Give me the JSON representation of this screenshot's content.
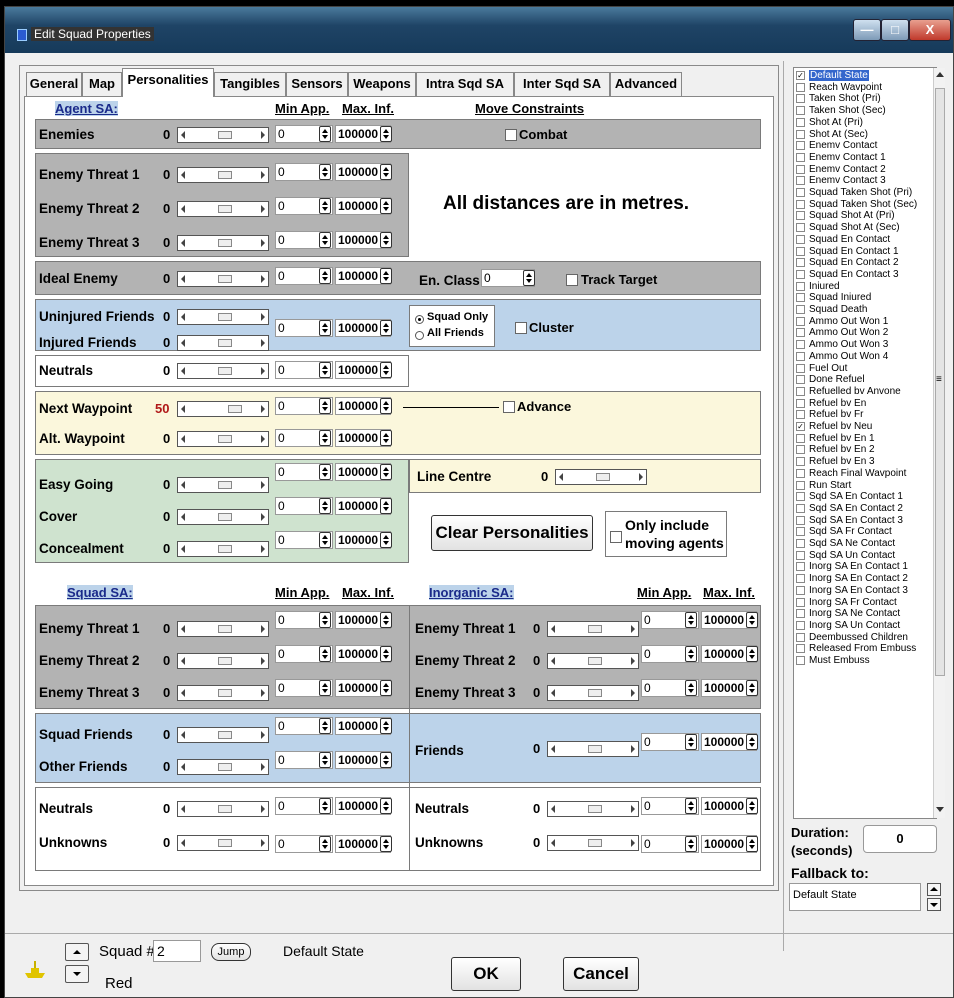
{
  "window": {
    "title": "Edit Squad Properties",
    "min": "—",
    "max": "□",
    "close": "X"
  },
  "tabs": [
    "General",
    "Map",
    "Personalities",
    "Tangibles",
    "Sensors",
    "Weapons",
    "Intra Sqd SA",
    "Inter Sqd SA",
    "Advanced"
  ],
  "active_tab": "Personalities",
  "agent_sa": {
    "header": "Agent SA:",
    "min_app": "Min App.",
    "max_inf": "Max. Inf.",
    "move_constraints": "Move Constraints",
    "rows": {
      "enemies": {
        "label": "Enemies",
        "value": "0",
        "min": "0",
        "max": "100000"
      },
      "enemy_threat_1": {
        "label": "Enemy Threat 1",
        "value": "0",
        "min": "0",
        "max": "100000"
      },
      "enemy_threat_2": {
        "label": "Enemy Threat 2",
        "value": "0",
        "min": "0",
        "max": "100000"
      },
      "enemy_threat_3": {
        "label": "Enemy Threat 3",
        "value": "0",
        "min": "0",
        "max": "100000"
      },
      "ideal_enemy": {
        "label": "Ideal Enemy",
        "value": "0",
        "min": "0",
        "max": "100000"
      },
      "uninjured_friends": {
        "label": "Uninjured Friends",
        "value": "0"
      },
      "injured_friends": {
        "label": "Injured Friends",
        "value": "0"
      },
      "friends_min": "0",
      "friends_max": "100000",
      "neutrals": {
        "label": "Neutrals",
        "value": "0",
        "min": "0",
        "max": "100000"
      },
      "next_waypoint": {
        "label": "Next Waypoint",
        "value": "50",
        "min": "0",
        "max": "100000"
      },
      "alt_waypoint": {
        "label": "Alt. Waypoint",
        "value": "0",
        "min": "0",
        "max": "100000"
      },
      "easy_going": {
        "label": "Easy Going",
        "value": "0",
        "min": "0",
        "max": "100000"
      },
      "cover": {
        "label": "Cover",
        "value": "0",
        "min": "0",
        "max": "100000"
      },
      "concealment": {
        "label": "Concealment",
        "value": "0",
        "min": "0",
        "max": "100000"
      }
    },
    "combat": "Combat",
    "distances_note": "All distances are in metres.",
    "en_class_label": "En. Class",
    "en_class_value": "0",
    "track_target": "Track Target",
    "squad_only": "Squad Only",
    "all_friends": "All Friends",
    "cluster": "Cluster",
    "advance": "Advance",
    "line_centre": "Line Centre",
    "line_centre_value": "0",
    "clear_button": "Clear Personalities",
    "only_include": "Only include",
    "moving_agents": "moving agents"
  },
  "squad_sa": {
    "header": "Squad SA:",
    "min_app": "Min App.",
    "max_inf": "Max. Inf.",
    "rows": [
      {
        "label": "Enemy Threat 1",
        "value": "0",
        "min": "0",
        "max": "100000"
      },
      {
        "label": "Enemy Threat 2",
        "value": "0",
        "min": "0",
        "max": "100000"
      },
      {
        "label": "Enemy Threat 3",
        "value": "0",
        "min": "0",
        "max": "100000"
      },
      {
        "label": "Squad Friends",
        "value": "0",
        "min": "0",
        "max": "100000"
      },
      {
        "label": "Other Friends",
        "value": "0",
        "min": "0",
        "max": "100000"
      },
      {
        "label": "Neutrals",
        "value": "0",
        "min": "0",
        "max": "100000"
      },
      {
        "label": "Unknowns",
        "value": "0",
        "min": "0",
        "max": "100000"
      }
    ]
  },
  "inorganic_sa": {
    "header": "Inorganic SA:",
    "min_app": "Min App.",
    "max_inf": "Max. Inf.",
    "rows": [
      {
        "label": "Enemy Threat 1",
        "value": "0",
        "min": "0",
        "max": "100000"
      },
      {
        "label": "Enemy Threat 2",
        "value": "0",
        "min": "0",
        "max": "100000"
      },
      {
        "label": "Enemy Threat 3",
        "value": "0",
        "min": "0",
        "max": "100000"
      },
      {
        "label": "Friends",
        "value": "0",
        "min": "0",
        "max": "100000"
      },
      {
        "label": "Neutrals",
        "value": "0",
        "min": "0",
        "max": "100000"
      },
      {
        "label": "Unknowns",
        "value": "0",
        "min": "0",
        "max": "100000"
      }
    ]
  },
  "states": [
    {
      "label": "Default State",
      "checked": true,
      "selected": true
    },
    {
      "label": "Reach Wavpoint",
      "checked": false
    },
    {
      "label": "Taken Shot (Pri)",
      "checked": false
    },
    {
      "label": "Taken Shot (Sec)",
      "checked": false
    },
    {
      "label": "Shot At (Pri)",
      "checked": false
    },
    {
      "label": "Shot At (Sec)",
      "checked": false
    },
    {
      "label": "Enemv Contact",
      "checked": false
    },
    {
      "label": "Enemv Contact 1",
      "checked": false
    },
    {
      "label": "Enemv Contact 2",
      "checked": false
    },
    {
      "label": "Enemv Contact 3",
      "checked": false
    },
    {
      "label": "Squad Taken Shot (Pri)",
      "checked": false
    },
    {
      "label": "Squad Taken Shot (Sec)",
      "checked": false
    },
    {
      "label": "Squad Shot At (Pri)",
      "checked": false
    },
    {
      "label": "Squad Shot At (Sec)",
      "checked": false
    },
    {
      "label": "Squad En Contact",
      "checked": false
    },
    {
      "label": "Squad En Contact 1",
      "checked": false
    },
    {
      "label": "Squad En Contact 2",
      "checked": false
    },
    {
      "label": "Squad En Contact 3",
      "checked": false
    },
    {
      "label": "Iniured",
      "checked": false
    },
    {
      "label": "Squad Iniured",
      "checked": false
    },
    {
      "label": "Squad Death",
      "checked": false
    },
    {
      "label": "Ammo Out Won 1",
      "checked": false
    },
    {
      "label": "Ammo Out Won 2",
      "checked": false
    },
    {
      "label": "Ammo Out Won 3",
      "checked": false
    },
    {
      "label": "Ammo Out Won 4",
      "checked": false
    },
    {
      "label": "Fuel Out",
      "checked": false
    },
    {
      "label": "Done Refuel",
      "checked": false
    },
    {
      "label": "Refuelled bv Anvone",
      "checked": false
    },
    {
      "label": "Refuel bv En",
      "checked": false
    },
    {
      "label": "Refuel bv Fr",
      "checked": false
    },
    {
      "label": "Refuel bv Neu",
      "checked": true
    },
    {
      "label": "Refuel bv En 1",
      "checked": false
    },
    {
      "label": "Refuel bv En 2",
      "checked": false
    },
    {
      "label": "Refuel bv En 3",
      "checked": false
    },
    {
      "label": "Reach Final Wavpoint",
      "checked": false
    },
    {
      "label": "Run Start",
      "checked": false
    },
    {
      "label": "Sqd SA En Contact 1",
      "checked": false
    },
    {
      "label": "Sqd SA En Contact 2",
      "checked": false
    },
    {
      "label": "Sqd SA En Contact 3",
      "checked": false
    },
    {
      "label": "Sqd SA Fr Contact",
      "checked": false
    },
    {
      "label": "Sqd SA Ne Contact",
      "checked": false
    },
    {
      "label": "Sqd SA Un Contact",
      "checked": false
    },
    {
      "label": "Inorg SA En Contact 1",
      "checked": false
    },
    {
      "label": "Inorg SA En Contact 2",
      "checked": false
    },
    {
      "label": "Inorg SA En Contact 3",
      "checked": false
    },
    {
      "label": "Inorg SA Fr Contact",
      "checked": false
    },
    {
      "label": "Inorg SA Ne Contact",
      "checked": false
    },
    {
      "label": "Inorg SA Un Contact",
      "checked": false
    },
    {
      "label": "Deembussed Children",
      "checked": false
    },
    {
      "label": "Released From Embuss",
      "checked": false
    },
    {
      "label": "Must Embuss",
      "checked": false
    }
  ],
  "scroll_mark": "≡",
  "duration": {
    "label1": "Duration:",
    "label2": "(seconds)",
    "value": "0"
  },
  "fallback": {
    "label": "Fallback to:",
    "value": "Default State"
  },
  "footer": {
    "squad_label": "Squad #",
    "squad_number": "2",
    "jump": "Jump",
    "state": "Default State",
    "side": "Red",
    "ok": "OK",
    "cancel": "Cancel"
  }
}
